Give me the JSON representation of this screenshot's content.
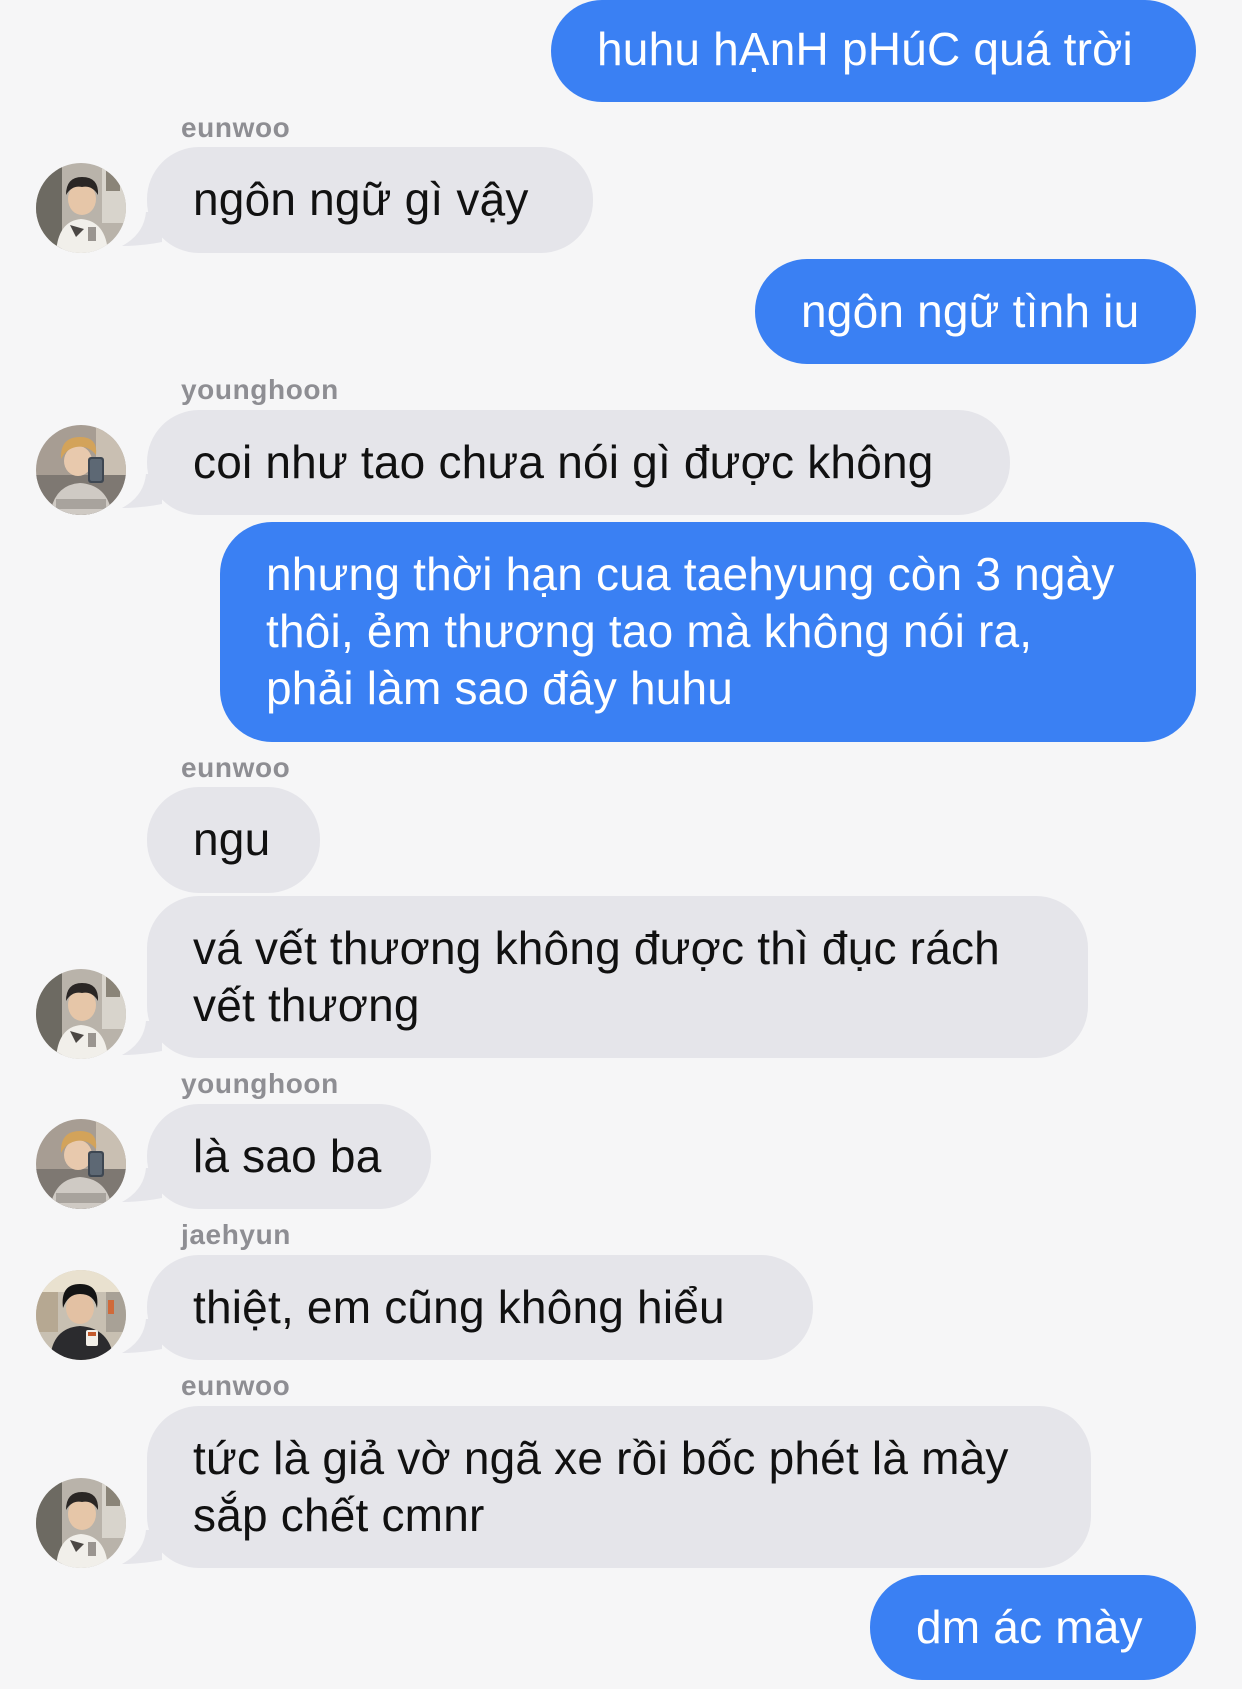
{
  "colors": {
    "background": "#f6f6f7",
    "outgoing_bubble": "#3a80f3",
    "incoming_bubble": "#e5e5ea",
    "sender_name": "#8e8e93"
  },
  "messages": [
    {
      "id": "m1",
      "direction": "outgoing",
      "lines": [
        "huhu hẠnH pHúC quá trời"
      ]
    },
    {
      "id": "m2",
      "direction": "incoming",
      "sender": "eunwoo",
      "lines": [
        "ngôn ngữ gì vậy"
      ]
    },
    {
      "id": "m3",
      "direction": "outgoing",
      "lines": [
        "ngôn ngữ tình iu"
      ]
    },
    {
      "id": "m4",
      "direction": "incoming",
      "sender": "younghoon",
      "lines": [
        "coi như tao chưa nói gì được không"
      ]
    },
    {
      "id": "m5",
      "direction": "outgoing",
      "lines": [
        "nhưng thời hạn cua taehyung còn 3 ngày",
        "thôi, ẻm thương tao mà không nói ra,",
        "phải làm sao đây huhu"
      ]
    },
    {
      "id": "m6",
      "direction": "incoming",
      "sender": "eunwoo",
      "lines": [
        "ngu"
      ]
    },
    {
      "id": "m7",
      "direction": "incoming",
      "lines": [
        "vá vết thương không được thì đục rách",
        "vết thương"
      ]
    },
    {
      "id": "m8",
      "direction": "incoming",
      "sender": "younghoon",
      "lines": [
        "là sao ba"
      ]
    },
    {
      "id": "m9",
      "direction": "incoming",
      "sender": "jaehyun",
      "lines": [
        "thiệt, em cũng không hiểu"
      ]
    },
    {
      "id": "m10",
      "direction": "incoming",
      "sender": "eunwoo",
      "lines": [
        "tức là giả vờ ngã xe rồi bốc phét là mày",
        "sắp chết cmnr"
      ]
    },
    {
      "id": "m11",
      "direction": "outgoing",
      "lines": [
        "dm ác mày"
      ]
    }
  ],
  "avatars": {
    "eunwoo": "avatar-eunwoo-photo",
    "younghoon": "avatar-younghoon-photo",
    "jaehyun": "avatar-jaehyun-photo"
  }
}
